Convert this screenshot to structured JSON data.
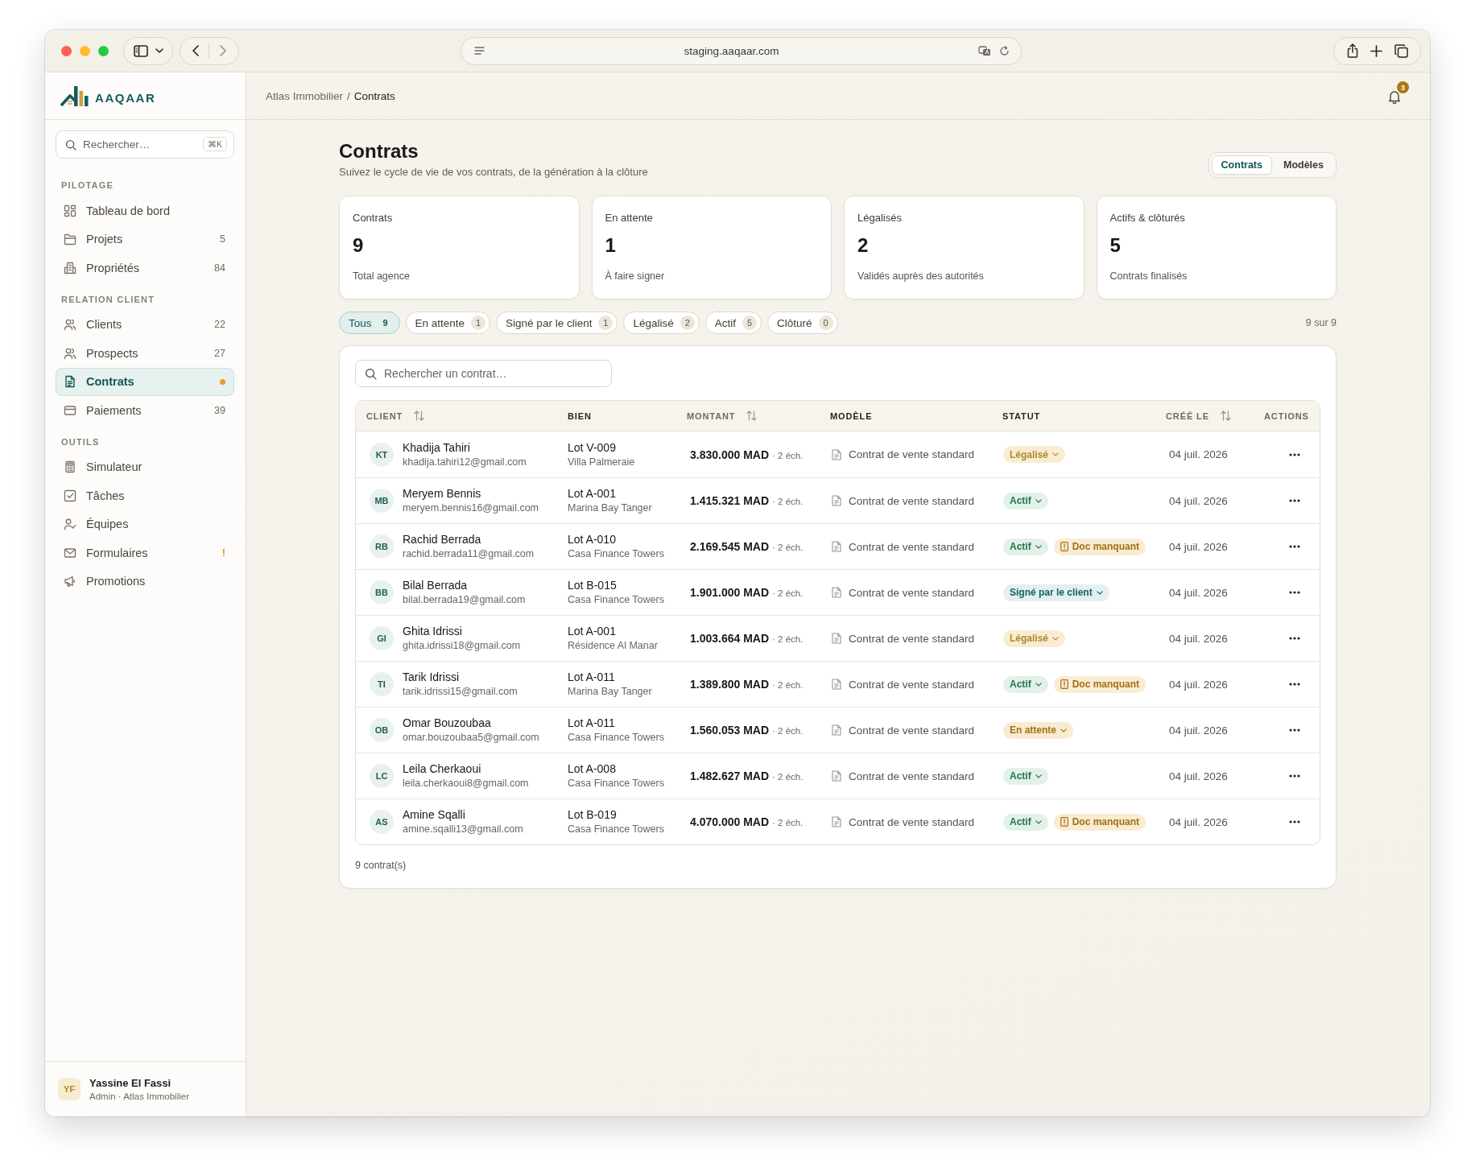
{
  "browser": {
    "url": "staging.aaqaar.com"
  },
  "sidebar": {
    "logo": "AAQAAR",
    "search": {
      "placeholder": "Rechercher…",
      "shortcut": "⌘K"
    },
    "sections": [
      {
        "title": "PILOTAGE",
        "items": [
          {
            "label": "Tableau de bord",
            "selected": false,
            "dot": false
          },
          {
            "label": "Projets",
            "count": "5",
            "selected": false,
            "dot": false
          },
          {
            "label": "Propriétés",
            "count": "84",
            "selected": false,
            "dot": false
          }
        ]
      },
      {
        "title": "RELATION CLIENT",
        "items": [
          {
            "label": "Clients",
            "count": "22",
            "selected": false,
            "dot": false
          },
          {
            "label": "Prospects",
            "count": "27",
            "selected": false,
            "dot": false
          },
          {
            "label": "Contrats",
            "selected": true,
            "dot": true
          },
          {
            "label": "Paiements",
            "count": "39",
            "selected": false,
            "dot": false
          }
        ]
      },
      {
        "title": "OUTILS",
        "items": [
          {
            "label": "Simulateur",
            "selected": false,
            "dot": false
          },
          {
            "label": "Tâches",
            "selected": false,
            "dot": false
          },
          {
            "label": "Équipes",
            "selected": false,
            "dot": false
          },
          {
            "label": "Formulaires",
            "warning": "!",
            "selected": false,
            "dot": false
          },
          {
            "label": "Promotions",
            "selected": false,
            "dot": false
          }
        ]
      }
    ],
    "user": {
      "initials": "YF",
      "name": "Yassine El Fassi",
      "role": "Admin · Atlas Immobilier"
    }
  },
  "header": {
    "breadcrumb": [
      "Atlas Immobilier",
      "Contrats"
    ],
    "separator": "/",
    "notifications": "3"
  },
  "page": {
    "title": "Contrats",
    "subtitle": "Suivez le cycle de vie de vos contrats, de la génération à la clôture",
    "views": [
      {
        "label": "Contrats",
        "selected": true
      },
      {
        "label": "Modèles",
        "selected": false
      }
    ]
  },
  "stats": [
    {
      "label": "Contrats",
      "value": "9",
      "caption": "Total agence"
    },
    {
      "label": "En attente",
      "value": "1",
      "caption": "À faire signer"
    },
    {
      "label": "Légalisés",
      "value": "2",
      "caption": "Validés auprès des autorités"
    },
    {
      "label": "Actifs & clôturés",
      "value": "5",
      "caption": "Contrats finalisés"
    }
  ],
  "filters": {
    "chips": [
      {
        "label": "Tous",
        "count": "9",
        "selected": true
      },
      {
        "label": "En attente",
        "count": "1",
        "selected": false
      },
      {
        "label": "Signé par le client",
        "count": "1",
        "selected": false
      },
      {
        "label": "Légalisé",
        "count": "2",
        "selected": false
      },
      {
        "label": "Actif",
        "count": "5",
        "selected": false
      },
      {
        "label": "Clôturé",
        "count": "0",
        "selected": false
      }
    ],
    "result": "9 sur 9"
  },
  "table": {
    "search": {
      "placeholder": "Rechercher un contrat…"
    },
    "columns": [
      {
        "label": "CLIENT",
        "kind": "client",
        "sortable": true
      },
      {
        "label": "BIEN",
        "kind": "property",
        "sortable": false
      },
      {
        "label": "MONTANT",
        "kind": "amount",
        "sortable": true
      },
      {
        "label": "MODÈLE",
        "kind": "template",
        "sortable": false
      },
      {
        "label": "STATUT",
        "kind": "status",
        "sortable": false
      },
      {
        "label": "CRÉÉ LE",
        "kind": "date",
        "sortable": true
      },
      {
        "label": "ACTIONS",
        "kind": "actions",
        "sortable": false
      }
    ],
    "rows": [
      {
        "client": {
          "initials": "KT",
          "name": "Khadija Tahiri",
          "email": "khadija.tahiri12@gmail.com"
        },
        "property": {
          "lot": "Lot V-009",
          "name": "Villa Palmeraie"
        },
        "amount": {
          "value": "3.830.000 MAD",
          "terms": "· 2 éch."
        },
        "template": "Contrat de vente standard",
        "status": {
          "label": "Légalisé",
          "kind": "legalise"
        },
        "date": "04 juil. 2026"
      },
      {
        "client": {
          "initials": "MB",
          "name": "Meryem Bennis",
          "email": "meryem.bennis16@gmail.com"
        },
        "property": {
          "lot": "Lot A-001",
          "name": "Marina Bay Tanger"
        },
        "amount": {
          "value": "1.415.321 MAD",
          "terms": "· 2 éch."
        },
        "template": "Contrat de vente standard",
        "status": {
          "label": "Actif",
          "kind": "actif"
        },
        "date": "04 juil. 2026"
      },
      {
        "client": {
          "initials": "RB",
          "name": "Rachid Berrada",
          "email": "rachid.berrada11@gmail.com"
        },
        "property": {
          "lot": "Lot A-010",
          "name": "Casa Finance Towers"
        },
        "amount": {
          "value": "2.169.545 MAD",
          "terms": "· 2 éch."
        },
        "template": "Contrat de vente standard",
        "status": {
          "label": "Actif",
          "kind": "actif"
        },
        "flag": "Doc manquant",
        "date": "04 juil. 2026"
      },
      {
        "client": {
          "initials": "BB",
          "name": "Bilal Berrada",
          "email": "bilal.berrada19@gmail.com"
        },
        "property": {
          "lot": "Lot B-015",
          "name": "Casa Finance Towers"
        },
        "amount": {
          "value": "1.901.000 MAD",
          "terms": "· 2 éch."
        },
        "template": "Contrat de vente standard",
        "status": {
          "label": "Signé par le client",
          "kind": "signe"
        },
        "date": "04 juil. 2026"
      },
      {
        "client": {
          "initials": "GI",
          "name": "Ghita Idrissi",
          "email": "ghita.idrissi18@gmail.com"
        },
        "property": {
          "lot": "Lot A-001",
          "name": "Résidence Al Manar"
        },
        "amount": {
          "value": "1.003.664 MAD",
          "terms": "· 2 éch."
        },
        "template": "Contrat de vente standard",
        "status": {
          "label": "Légalisé",
          "kind": "legalise"
        },
        "date": "04 juil. 2026"
      },
      {
        "client": {
          "initials": "TI",
          "name": "Tarik Idrissi",
          "email": "tarik.idrissi15@gmail.com"
        },
        "property": {
          "lot": "Lot A-011",
          "name": "Marina Bay Tanger"
        },
        "amount": {
          "value": "1.389.800 MAD",
          "terms": "· 2 éch."
        },
        "template": "Contrat de vente standard",
        "status": {
          "label": "Actif",
          "kind": "actif"
        },
        "flag": "Doc manquant",
        "date": "04 juil. 2026"
      },
      {
        "client": {
          "initials": "OB",
          "name": "Omar Bouzoubaa",
          "email": "omar.bouzoubaa5@gmail.com"
        },
        "property": {
          "lot": "Lot A-011",
          "name": "Casa Finance Towers"
        },
        "amount": {
          "value": "1.560.053 MAD",
          "terms": "· 2 éch."
        },
        "template": "Contrat de vente standard",
        "status": {
          "label": "En attente",
          "kind": "attente"
        },
        "date": "04 juil. 2026"
      },
      {
        "client": {
          "initials": "LC",
          "name": "Leila Cherkaoui",
          "email": "leila.cherkaoui8@gmail.com"
        },
        "property": {
          "lot": "Lot A-008",
          "name": "Casa Finance Towers"
        },
        "amount": {
          "value": "1.482.627 MAD",
          "terms": "· 2 éch."
        },
        "template": "Contrat de vente standard",
        "status": {
          "label": "Actif",
          "kind": "actif"
        },
        "date": "04 juil. 2026"
      },
      {
        "client": {
          "initials": "AS",
          "name": "Amine Sqalli",
          "email": "amine.sqalli13@gmail.com"
        },
        "property": {
          "lot": "Lot B-019",
          "name": "Casa Finance Towers"
        },
        "amount": {
          "value": "4.070.000 MAD",
          "terms": "· 2 éch."
        },
        "template": "Contrat de vente standard",
        "status": {
          "label": "Actif",
          "kind": "actif"
        },
        "flag": "Doc manquant",
        "date": "04 juil. 2026"
      }
    ],
    "footer": "9 contrat(s)"
  }
}
